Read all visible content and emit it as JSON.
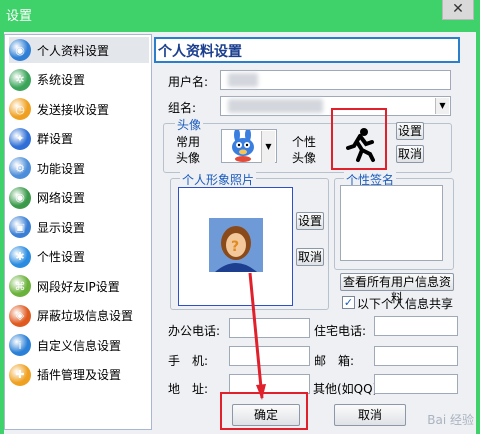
{
  "window": {
    "title": "设置",
    "close_glyph": "✕"
  },
  "sidebar": {
    "items": [
      {
        "label": "个人资料设置",
        "icon": "globe-icon",
        "color": "#2f7fd6",
        "active": true
      },
      {
        "label": "系统设置",
        "icon": "gear-icon",
        "color": "#3aa55a"
      },
      {
        "label": "发送接收设置",
        "icon": "clock-icon",
        "color": "#f0a020"
      },
      {
        "label": "群设置",
        "icon": "bird-icon",
        "color": "#2f6fd6"
      },
      {
        "label": "功能设置",
        "icon": "cog-icon",
        "color": "#4c8ed9"
      },
      {
        "label": "网络设置",
        "icon": "globe-icon",
        "color": "#3a9a4a"
      },
      {
        "label": "显示设置",
        "icon": "monitor-icon",
        "color": "#3b7fd4"
      },
      {
        "label": "个性设置",
        "icon": "snowflake-icon",
        "color": "#2a8be0"
      },
      {
        "label": "网段好友IP设置",
        "icon": "network-icon",
        "color": "#6ab23a"
      },
      {
        "label": "屏蔽垃圾信息设置",
        "icon": "shield-icon",
        "color": "#e05a20"
      },
      {
        "label": "自定义信息设置",
        "icon": "info-icon",
        "color": "#2a7fd6"
      },
      {
        "label": "插件管理及设置",
        "icon": "plugin-icon",
        "color": "#f0a020"
      }
    ]
  },
  "header": {
    "title": "个人资料设置"
  },
  "form": {
    "username_label": "用户名:",
    "groupname_label": "组名:",
    "avatar_legend": "头像",
    "common_label_1": "常用",
    "common_label_2": "头像",
    "custom_label_1": "个性",
    "custom_label_2": "头像",
    "avatar_set": "设置",
    "avatar_cancel": "取消",
    "photo_legend": "个人形象照片",
    "photo_set": "设置",
    "photo_cancel": "取消",
    "signature_legend": "个性签名",
    "view_all_button": "查看所有用户信息资料",
    "share_checkbox_label": "以下个人信息共享",
    "share_checked": true,
    "office_phone_label": "办公电话:",
    "home_phone_label": "住宅电话:",
    "mobile_label": "手　机:",
    "email_label": "邮　箱:",
    "address_label": "地　址:",
    "other_label": "其他(如QQ):"
  },
  "footer": {
    "ok": "确定",
    "cancel": "取消"
  },
  "watermark": "Bai 经验",
  "colors": {
    "titlebar": "#3fd16a",
    "header_border": "#2b7ec9",
    "annotation": "#e0202b"
  }
}
